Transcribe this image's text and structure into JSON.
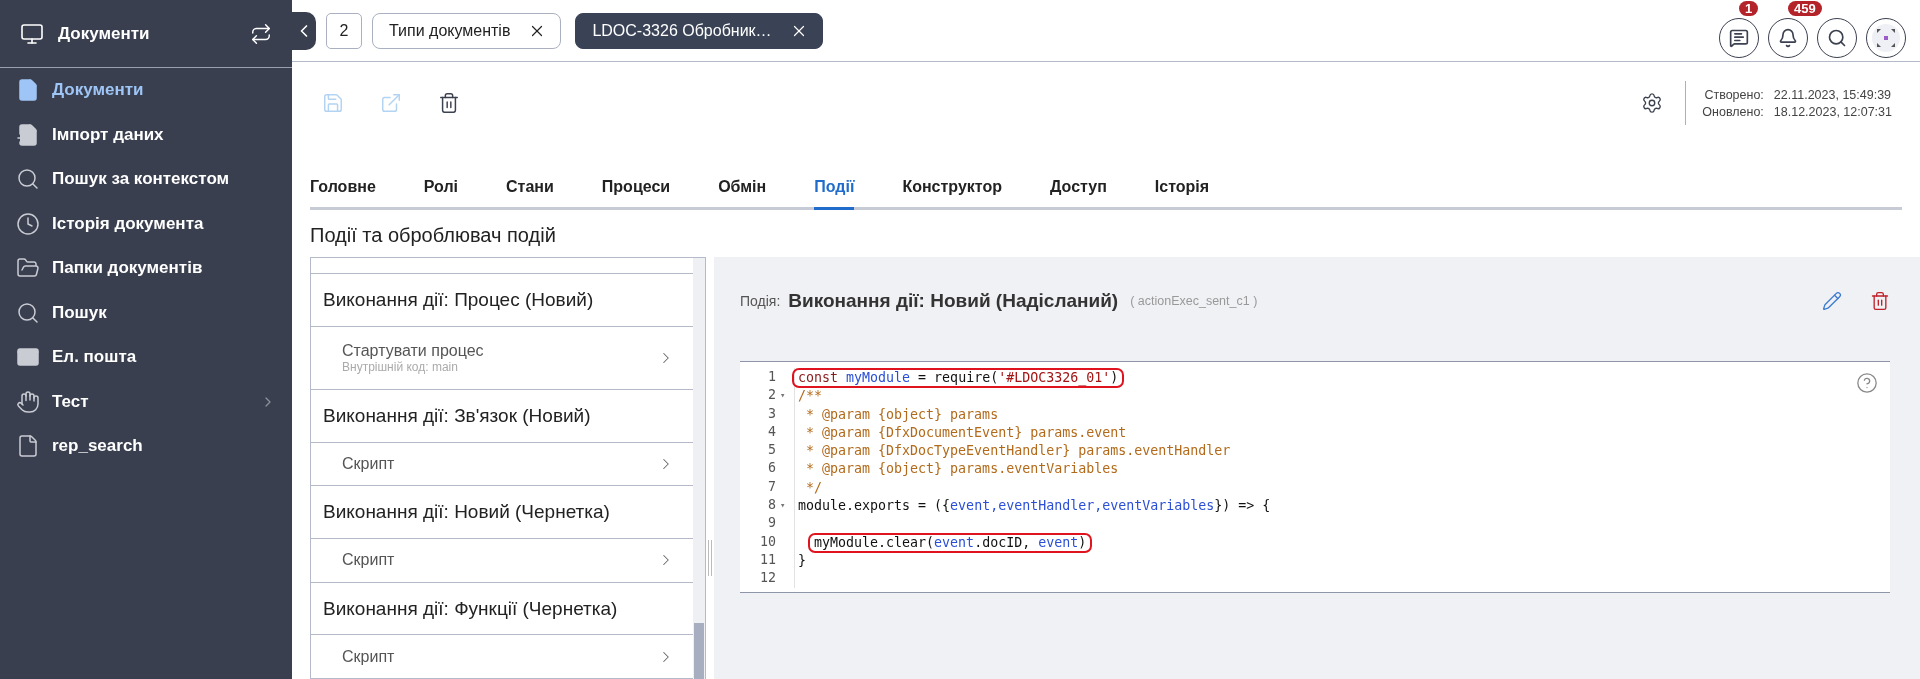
{
  "sidebar": {
    "title": "Документи",
    "items": [
      {
        "label": "Документи",
        "selected": true,
        "submenu": false
      },
      {
        "label": "Імпорт даних",
        "selected": false,
        "submenu": false
      },
      {
        "label": "Пошук за контекстом",
        "selected": false,
        "submenu": false
      },
      {
        "label": "Історія документа",
        "selected": false,
        "submenu": false
      },
      {
        "label": "Папки документів",
        "selected": false,
        "submenu": false
      },
      {
        "label": "Пошук",
        "selected": false,
        "submenu": false
      },
      {
        "label": "Ел. пошта",
        "selected": false,
        "submenu": false
      },
      {
        "label": "Тест",
        "selected": false,
        "submenu": true
      },
      {
        "label": "rep_search",
        "selected": false,
        "submenu": false
      }
    ]
  },
  "open_documents": {
    "count": "2",
    "tabs": [
      {
        "label": "Типи документів",
        "selected": false
      },
      {
        "label": "LDOC-3326 Обробник…",
        "selected": true
      }
    ]
  },
  "header": {
    "message_badge": "1",
    "bell_badge": "459"
  },
  "toolbar": {
    "actions": [
      {
        "disabled": true
      },
      {
        "disabled": true
      },
      {
        "disabled": false
      }
    ],
    "meta": [
      {
        "label": "Створено:",
        "value": "22.11.2023, 15:49:39"
      },
      {
        "label": "Оновлено:",
        "value": "18.12.2023, 12:07:31"
      }
    ]
  },
  "tabs": [
    {
      "label": "Головне",
      "selected": false
    },
    {
      "label": "Ролі",
      "selected": false
    },
    {
      "label": "Стани",
      "selected": false
    },
    {
      "label": "Процеси",
      "selected": false
    },
    {
      "label": "Обмін",
      "selected": false
    },
    {
      "label": "Події",
      "selected": true
    },
    {
      "label": "Конструктор",
      "selected": false
    },
    {
      "label": "Доступ",
      "selected": false
    },
    {
      "label": "Історія",
      "selected": false
    }
  ],
  "section_title": "Події та оброблювач подій",
  "event_list": [
    {
      "kind": "header",
      "title": "Виконання дії: Процес (Новий)"
    },
    {
      "kind": "item",
      "title": "Стартувати процес",
      "subtitle": "Внутрішній код: main"
    },
    {
      "kind": "header",
      "title": "Виконання дії: Зв'язок (Новий)"
    },
    {
      "kind": "item",
      "title": "Скрипт"
    },
    {
      "kind": "header",
      "title": "Виконання дії: Новий (Чернетка)"
    },
    {
      "kind": "item",
      "title": "Скрипт"
    },
    {
      "kind": "header",
      "title": "Виконання дії: Функції (Чернетка)"
    },
    {
      "kind": "item",
      "title": "Скрипт"
    }
  ],
  "event": {
    "label": "Подія:",
    "title": "Виконання дії: Новий (Надісланий)",
    "code": "( actionExec_sent_c1 )"
  },
  "editor": {
    "lines": [
      {
        "number": "1",
        "highlighted": true,
        "indent": false,
        "tokens": [
          {
            "kind": "keyword",
            "text": "const "
          },
          {
            "kind": "variable",
            "text": "myModule"
          },
          {
            "kind": "plain",
            "text": " = require("
          },
          {
            "kind": "string",
            "text": "'#LDOC3326_01'"
          },
          {
            "kind": "plain",
            "text": ")"
          }
        ]
      },
      {
        "number": "2",
        "fold": "▾",
        "highlighted": false,
        "indent": false,
        "tokens": [
          {
            "kind": "comment",
            "text": "/**"
          }
        ]
      },
      {
        "number": "3",
        "highlighted": false,
        "indent": false,
        "tokens": [
          {
            "kind": "comment",
            "text": " * @param {object} params"
          }
        ]
      },
      {
        "number": "4",
        "highlighted": false,
        "indent": false,
        "tokens": [
          {
            "kind": "comment",
            "text": " * @param {DfxDocumentEvent} params.event"
          }
        ]
      },
      {
        "number": "5",
        "highlighted": false,
        "indent": false,
        "tokens": [
          {
            "kind": "comment",
            "text": " * @param {DfxDocTypeEventHandler} params.eventHandler"
          }
        ]
      },
      {
        "number": "6",
        "highlighted": false,
        "indent": false,
        "tokens": [
          {
            "kind": "comment",
            "text": " * @param {object} params.eventVariables"
          }
        ]
      },
      {
        "number": "7",
        "highlighted": false,
        "indent": false,
        "tokens": [
          {
            "kind": "comment",
            "text": " */"
          }
        ]
      },
      {
        "number": "8",
        "fold": "▾",
        "highlighted": false,
        "indent": false,
        "tokens": [
          {
            "kind": "plain",
            "text": "module.exports = ({"
          },
          {
            "kind": "variable",
            "text": "event,"
          },
          {
            "kind": "variable",
            "text": "eventHandler,"
          },
          {
            "kind": "variable",
            "text": "eventVariables"
          },
          {
            "kind": "plain",
            "text": "}) => {"
          }
        ]
      },
      {
        "number": "9"
      },
      {
        "number": "10",
        "highlighted": true,
        "indent": true,
        "tokens": [
          {
            "kind": "plain",
            "text": "myModule.clear("
          },
          {
            "kind": "variable",
            "text": "event"
          },
          {
            "kind": "plain",
            "text": ".docID, "
          },
          {
            "kind": "variable",
            "text": "event"
          },
          {
            "kind": "plain",
            "text": ")"
          }
        ]
      },
      {
        "number": "11",
        "highlighted": false,
        "indent": false,
        "tokens": [
          {
            "kind": "plain",
            "text": "}"
          }
        ]
      },
      {
        "number": "12"
      }
    ]
  }
}
